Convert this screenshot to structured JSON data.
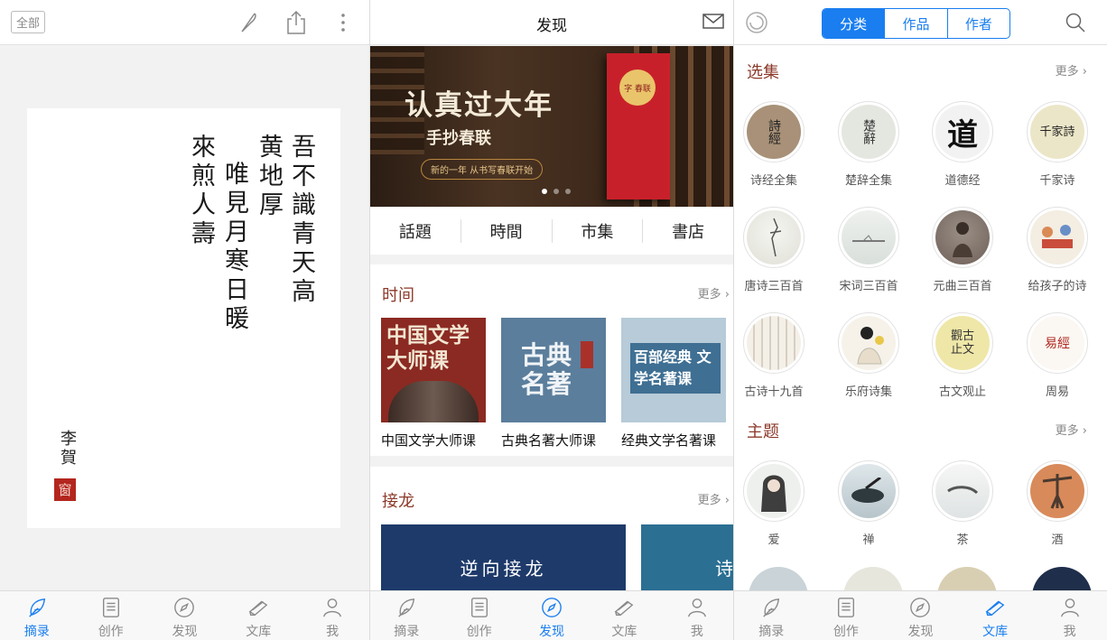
{
  "panel1": {
    "filter_label": "全部",
    "poem_columns": [
      "吾不識青天高",
      "黄地厚",
      "唯見月寒日暖",
      "來煎人壽"
    ],
    "author": "李賀",
    "seal": "窗"
  },
  "panel2": {
    "title": "发现",
    "banner": {
      "headline": "认真过大年",
      "subline": "手抄春联",
      "pill": "新的一年 从书写春联开始",
      "book_text": "字 春联"
    },
    "categories": [
      "話題",
      "時間",
      "市集",
      "書店"
    ],
    "time_section": {
      "title": "时间",
      "more": "更多",
      "courses": [
        {
          "label": "中国文学大师课",
          "art": "中国文学大师课"
        },
        {
          "label": "古典名著大师课",
          "art": "古典名著"
        },
        {
          "label": "经典文学名著课",
          "art": "百部经典 文学名著课"
        }
      ]
    },
    "relay_section": {
      "title": "接龙",
      "more": "更多",
      "card1": "逆向接龙",
      "card2": "诗"
    }
  },
  "panel3": {
    "segments": [
      "分类",
      "作品",
      "作者"
    ],
    "selected_segment": "分类",
    "anthology": {
      "title": "选集",
      "more": "更多",
      "items": [
        {
          "label": "诗经全集",
          "art": "詩經"
        },
        {
          "label": "楚辞全集",
          "art": "楚辭"
        },
        {
          "label": "道德经",
          "art": "道"
        },
        {
          "label": "千家诗",
          "art": "千家詩"
        },
        {
          "label": "唐诗三百首",
          "art": ""
        },
        {
          "label": "宋词三百首",
          "art": ""
        },
        {
          "label": "元曲三百首",
          "art": ""
        },
        {
          "label": "给孩子的诗",
          "art": ""
        },
        {
          "label": "古诗十九首",
          "art": ""
        },
        {
          "label": "乐府诗集",
          "art": ""
        },
        {
          "label": "古文观止",
          "art": "觀古 止文"
        },
        {
          "label": "周易",
          "art": "易經"
        }
      ]
    },
    "themes": {
      "title": "主题",
      "more": "更多",
      "items": [
        {
          "label": "爱"
        },
        {
          "label": "禅"
        },
        {
          "label": "茶"
        },
        {
          "label": "酒"
        }
      ]
    }
  },
  "tabbar": {
    "tabs": [
      "摘录",
      "创作",
      "发现",
      "文库",
      "我"
    ],
    "active_panel1": "摘录",
    "active_panel2": "发现",
    "active_panel3": "文库"
  },
  "colors": {
    "accent": "#1a7ef0",
    "section_title": "#8c3a2a",
    "seal": "#b3261e"
  }
}
